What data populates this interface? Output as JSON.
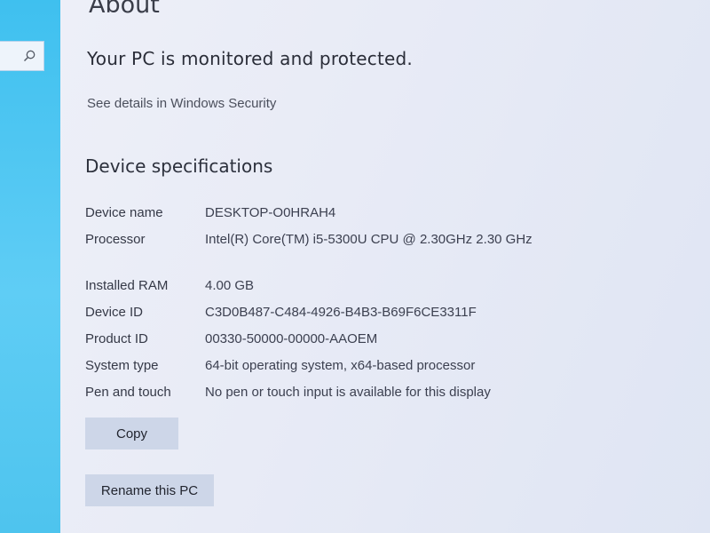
{
  "sidebar": {
    "search_icon": "search-icon",
    "accent_color": "#4cc4ef"
  },
  "page": {
    "title": "About",
    "protection_status": "Your PC is monitored and protected.",
    "security_link": "See details in Windows Security"
  },
  "device_specs": {
    "heading": "Device specifications",
    "rows": [
      {
        "label": "Device name",
        "value": "DESKTOP-O0HRAH4"
      },
      {
        "label": "Processor",
        "value": "Intel(R) Core(TM) i5-5300U CPU @ 2.30GHz   2.30 GHz"
      },
      {
        "label": "Installed RAM",
        "value": "4.00 GB"
      },
      {
        "label": "Device ID",
        "value": "C3D0B487-C484-4926-B4B3-B69F6CE3311F"
      },
      {
        "label": "Product ID",
        "value": "00330-50000-00000-AAOEM"
      },
      {
        "label": "System type",
        "value": "64-bit operating system, x64-based processor"
      },
      {
        "label": "Pen and touch",
        "value": "No pen or touch input is available for this display"
      }
    ]
  },
  "buttons": {
    "copy_label": "Copy",
    "rename_label": "Rename this PC"
  }
}
